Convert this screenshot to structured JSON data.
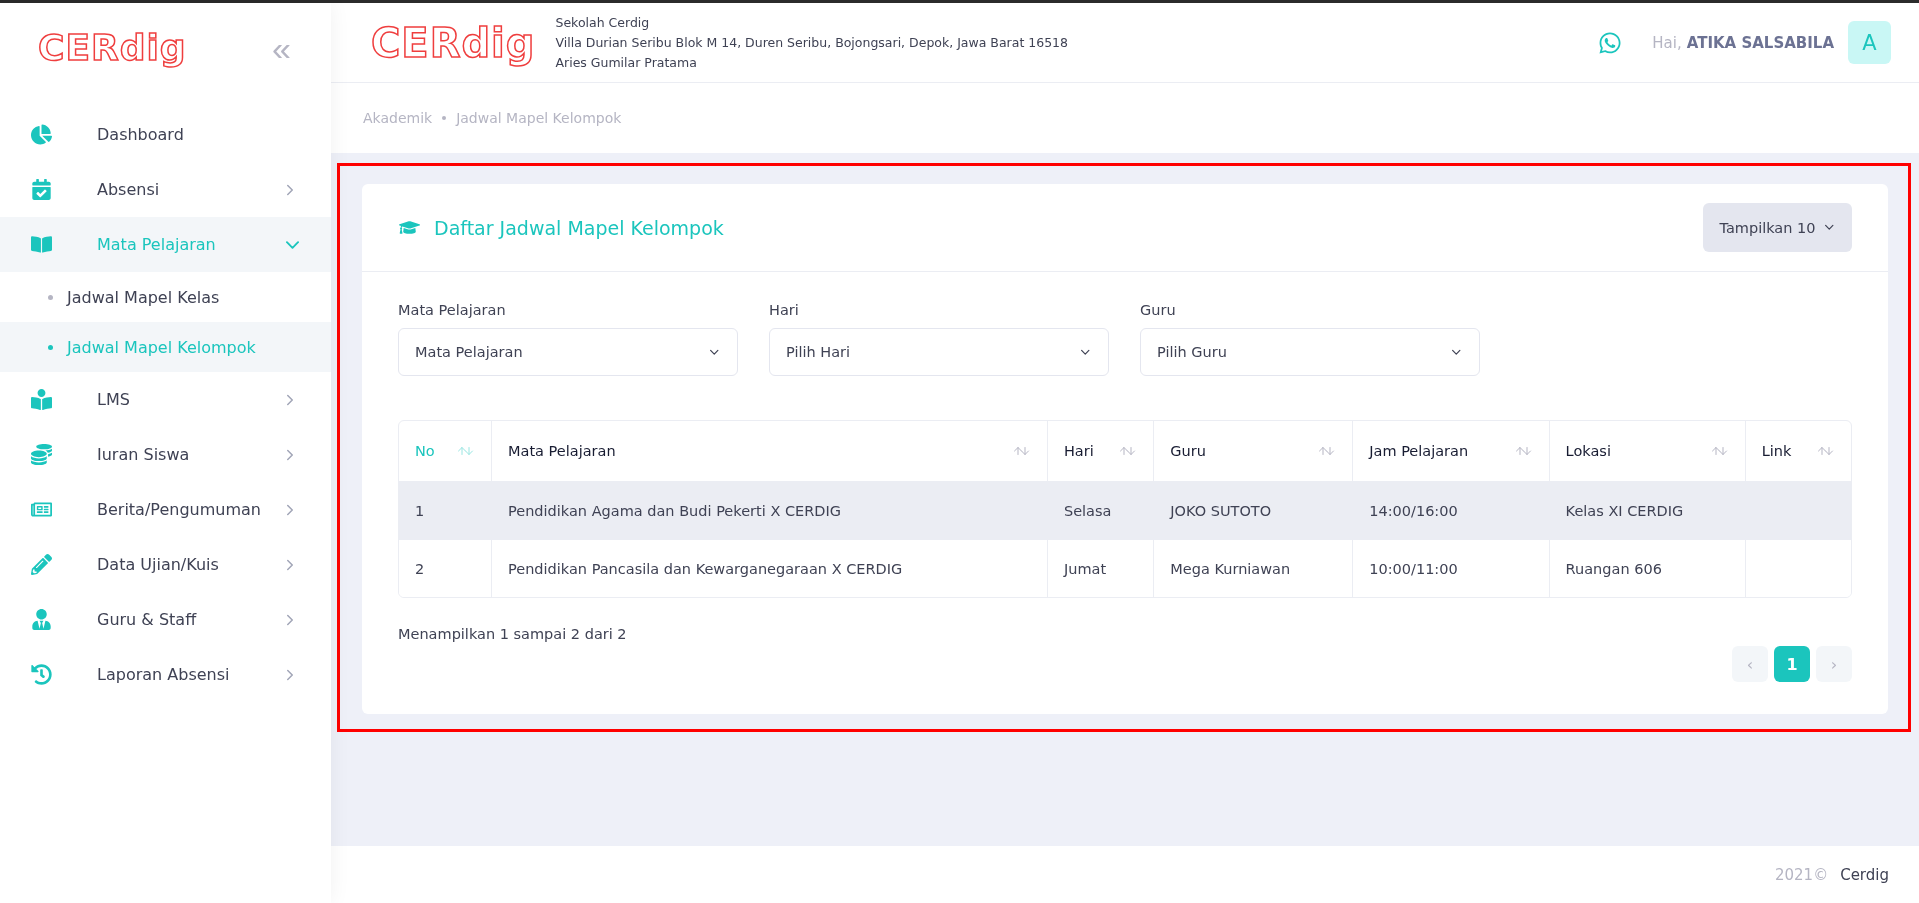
{
  "sidebar": {
    "logo": "CERdig",
    "collapse_icon": "«",
    "items": [
      {
        "label": "Dashboard",
        "kind": "plain",
        "selected": false
      },
      {
        "label": "Absensi",
        "kind": "group",
        "expanded": false,
        "selected": false
      },
      {
        "label": "Mata Pelajaran",
        "kind": "group",
        "expanded": true,
        "selected": true,
        "children": [
          {
            "label": "Jadwal Mapel Kelas",
            "selected": false
          },
          {
            "label": "Jadwal Mapel Kelompok",
            "selected": true
          }
        ]
      },
      {
        "label": "LMS",
        "kind": "group",
        "expanded": false,
        "selected": false
      },
      {
        "label": "Iuran Siswa",
        "kind": "group",
        "expanded": false,
        "selected": false
      },
      {
        "label": "Berita/Pengumuman",
        "kind": "group",
        "expanded": false,
        "selected": false
      },
      {
        "label": "Data Ujian/Kuis",
        "kind": "group",
        "expanded": false,
        "selected": false
      },
      {
        "label": "Guru & Staff",
        "kind": "group",
        "expanded": false,
        "selected": false
      },
      {
        "label": "Laporan Absensi",
        "kind": "group",
        "expanded": false,
        "selected": false
      }
    ]
  },
  "header": {
    "logo": "CERdig",
    "school": "Sekolah Cerdig",
    "address": "Villa Durian Seribu Blok M 14, Duren Seribu, Bojongsari, Depok, Jawa Barat 16518",
    "principal": "Aries Gumilar Pratama",
    "greeting": "Hai,",
    "user": "ATIKA SALSABILA",
    "avatar": "A"
  },
  "breadcrumb": [
    "Akademik",
    "Jadwal Mapel Kelompok"
  ],
  "card": {
    "title": "Daftar Jadwal Mapel Kelompok",
    "page_size_button": "Tampilkan 10",
    "filters": [
      {
        "label": "Mata Pelajaran",
        "value": "Mata Pelajaran"
      },
      {
        "label": "Hari",
        "value": "Pilih Hari"
      },
      {
        "label": "Guru",
        "value": "Pilih Guru"
      }
    ],
    "table": {
      "columns": [
        {
          "label": "No",
          "sorted": true
        },
        {
          "label": "Mata Pelajaran",
          "sorted": false
        },
        {
          "label": "Hari",
          "sorted": false
        },
        {
          "label": "Guru",
          "sorted": false
        },
        {
          "label": "Jam Pelajaran",
          "sorted": false
        },
        {
          "label": "Lokasi",
          "sorted": false
        },
        {
          "label": "Link",
          "sorted": false
        }
      ],
      "rows": [
        {
          "selected": true,
          "cells": [
            "1",
            "Pendidikan Agama dan Budi Pekerti X CERDIG",
            "Selasa",
            "JOKO SUTOTO",
            "14:00/16:00",
            "Kelas XI CERDIG",
            ""
          ]
        },
        {
          "selected": false,
          "cells": [
            "2",
            "Pendidikan Pancasila dan Kewarganegaraan X CERDIG",
            "Jumat",
            "Mega Kurniawan",
            "10:00/11:00",
            "Ruangan 606",
            ""
          ]
        }
      ]
    },
    "summary": "Menampilkan 1 sampai 2 dari 2",
    "pagination": {
      "prev": "‹",
      "next": "›",
      "pages": [
        {
          "label": "1",
          "selected": true
        }
      ]
    }
  },
  "footer": {
    "year": "2021©",
    "brand": "Cerdig"
  }
}
